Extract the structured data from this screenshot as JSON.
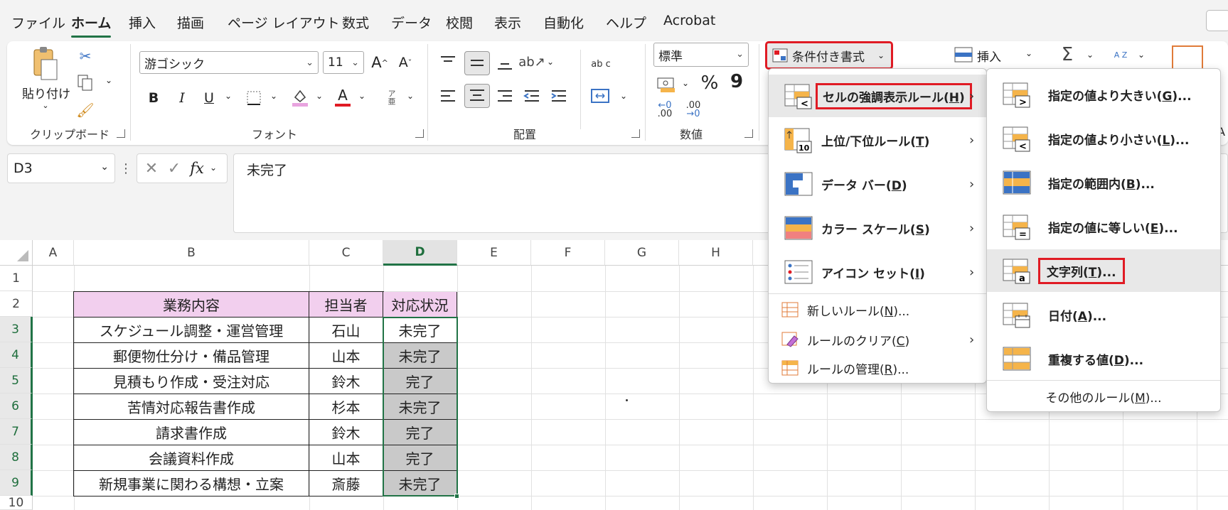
{
  "menubar": {
    "tabs": [
      "ファイル",
      "ホーム",
      "挿入",
      "描画",
      "ページ レイアウト",
      "数式",
      "データ",
      "校閲",
      "表示",
      "自動化",
      "ヘルプ",
      "Acrobat"
    ],
    "active": "ホーム"
  },
  "ribbon": {
    "clipboard": {
      "paste": "貼り付け",
      "label": "クリップボード"
    },
    "font": {
      "name": "游ゴシック",
      "size": "11",
      "label": "フォント",
      "bold": "B",
      "italic": "I",
      "underline": "U",
      "grow": "A",
      "shrink": "A",
      "color_a": "A",
      "furigana": "ア亜"
    },
    "alignment": {
      "label": "配置",
      "wrap": "ab c"
    },
    "number": {
      "format": "標準",
      "label": "数値",
      "percent": "%",
      "comma": "9"
    },
    "styles": {
      "conditional": "条件付き書式"
    },
    "cells": {
      "insert": "挿入"
    },
    "editing": {
      "sum": "Σ",
      "sort": "A Z"
    },
    "cut_edge": "A"
  },
  "formula_bar": {
    "name_box": "D3",
    "fx": "fx",
    "content": "未完了"
  },
  "sheet": {
    "columns": [
      "A",
      "B",
      "C",
      "D",
      "E",
      "F",
      "G",
      "H"
    ],
    "rows": [
      "1",
      "2",
      "3",
      "4",
      "5",
      "6",
      "7",
      "8",
      "9",
      "10"
    ],
    "selected_col": "D",
    "table": {
      "headers": [
        "業務内容",
        "担当者",
        "対応状況"
      ],
      "rows": [
        [
          "スケジュール調整・運営管理",
          "石山",
          "未完了"
        ],
        [
          "郵便物仕分け・備品管理",
          "山本",
          "未完了"
        ],
        [
          "見積もり作成・受注対応",
          "鈴木",
          "完了"
        ],
        [
          "苦情対応報告書作成",
          "杉本",
          "未完了"
        ],
        [
          "請求書作成",
          "鈴木",
          "完了"
        ],
        [
          "会議資料作成",
          "山本",
          "完了"
        ],
        [
          "新規事業に関わる構想・立案",
          "斎藤",
          "未完了"
        ]
      ]
    },
    "header_fill": "#f2cfee",
    "selected_fill": "#c9c9c9"
  },
  "cf_menu": {
    "items": [
      {
        "label": "セルの強調表示ルール(",
        "key": "H",
        "end": ")"
      },
      {
        "label": "上位/下位ルール(",
        "key": "T",
        "end": ")"
      },
      {
        "label": "データ バー(",
        "key": "D",
        "end": ")"
      },
      {
        "label": "カラー スケール(",
        "key": "S",
        "end": ")"
      },
      {
        "label": "アイコン セット(",
        "key": "I",
        "end": ")"
      }
    ],
    "small": [
      {
        "label": "新しいルール(",
        "key": "N",
        "end": ")..."
      },
      {
        "label": "ルールのクリア(",
        "key": "C",
        "end": ")"
      },
      {
        "label": "ルールの管理(",
        "key": "R",
        "end": ")..."
      }
    ]
  },
  "sub_menu": {
    "items": [
      {
        "label": "指定の値より大きい(",
        "key": "G",
        "end": ")..."
      },
      {
        "label": "指定の値より小さい(",
        "key": "L",
        "end": ")..."
      },
      {
        "label": "指定の範囲内(",
        "key": "B",
        "end": ")..."
      },
      {
        "label": "指定の値に等しい(",
        "key": "E",
        "end": ")..."
      },
      {
        "label": "文字列(",
        "key": "T",
        "end": ")..."
      },
      {
        "label": "日付(",
        "key": "A",
        "end": ")..."
      },
      {
        "label": "重複する値(",
        "key": "D",
        "end": ")..."
      }
    ],
    "other": {
      "label": "その他のルール(",
      "key": "M",
      "end": ")..."
    }
  },
  "colors": {
    "accent": "#217346",
    "highlight": "#e01b24",
    "icon_orange": "#f5b44a",
    "icon_blue": "#3b73c4"
  }
}
